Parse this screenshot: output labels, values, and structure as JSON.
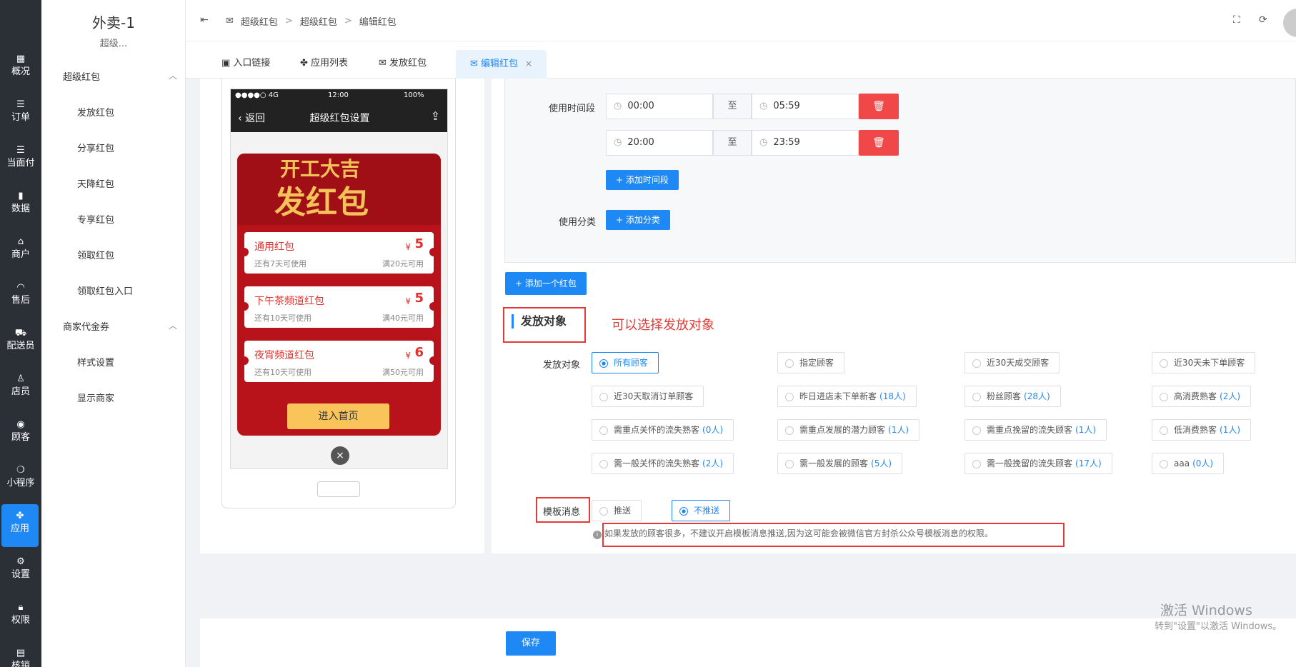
{
  "leftnav": [
    {
      "icon": "dashboard-icon",
      "glyph": "▦",
      "label": "概况"
    },
    {
      "icon": "list-icon",
      "glyph": "☰",
      "label": "订单"
    },
    {
      "icon": "list-icon",
      "glyph": "☰",
      "label": "当面付"
    },
    {
      "icon": "bar-chart-icon",
      "glyph": "▮",
      "label": "数据"
    },
    {
      "icon": "store-icon",
      "glyph": "⌂",
      "label": "商户"
    },
    {
      "icon": "headset-icon",
      "glyph": "◠",
      "label": "售后"
    },
    {
      "icon": "truck-icon",
      "glyph": "⛟",
      "label": "配送员"
    },
    {
      "icon": "people-icon",
      "glyph": "♙",
      "label": "店员"
    },
    {
      "icon": "user-circle-icon",
      "glyph": "◉",
      "label": "顾客"
    },
    {
      "icon": "wechat-icon",
      "glyph": "❍",
      "label": "小程序"
    },
    {
      "icon": "apps-icon",
      "glyph": "✤",
      "label": "应用"
    },
    {
      "icon": "settings-user-icon",
      "glyph": "⚙",
      "label": "设置"
    },
    {
      "icon": "lock-icon",
      "glyph": "🔒︎",
      "label": "权限"
    },
    {
      "icon": "document-icon",
      "glyph": "▤",
      "label": "核销"
    }
  ],
  "subnav": {
    "title": "外卖-1",
    "subtitle": "超级...",
    "group1": "超级红包",
    "group1_items": [
      "发放红包",
      "分享红包",
      "天降红包",
      "专享红包",
      "领取红包",
      "领取红包入口"
    ],
    "group2": "商家代金券",
    "group2_items": [
      "样式设置",
      "显示商家"
    ]
  },
  "breadcrumb": [
    "超级红包",
    "超级红包",
    "编辑红包"
  ],
  "tabs": [
    {
      "label": "入口链接",
      "icon": "vip-icon"
    },
    {
      "label": "应用列表",
      "icon": "apps-icon"
    },
    {
      "label": "发放红包",
      "icon": "envelope-icon"
    },
    {
      "label": "编辑红包",
      "icon": "envelope-icon",
      "active": true
    }
  ],
  "phone": {
    "carrier": "●●●●○ 4G",
    "time": "12:00",
    "battery": "100%",
    "back": "返回",
    "title": "超级红包设置",
    "banner1": "开工大吉",
    "banner2": "发红包",
    "coupons": [
      {
        "name": "通用红包",
        "amount": "5",
        "sub": "还有7天可使用",
        "cond": "满20元可用"
      },
      {
        "name": "下午茶频道红包",
        "amount": "5",
        "sub": "还有10天可使用",
        "cond": "满40元可用"
      },
      {
        "name": "夜宵频道红包",
        "amount": "6",
        "sub": "还有10天可使用",
        "cond": "满50元可用"
      }
    ],
    "yen": "¥",
    "enter": "进入首页"
  },
  "form": {
    "time_label": "使用时间段",
    "ranges": [
      {
        "start": "00:00",
        "end": "05:59"
      },
      {
        "start": "20:00",
        "end": "23:59"
      }
    ],
    "to": "至",
    "add_time": "+ 添加时间段",
    "category_label": "使用分类",
    "add_category": "+ 添加分类",
    "add_packet": "+ 添加一个红包",
    "section": "发放对象",
    "annotation": "可以选择发放对象",
    "target_label": "发放对象",
    "targets": [
      {
        "label": "所有顾客",
        "count": "",
        "checked": true
      },
      {
        "label": "指定顾客",
        "count": ""
      },
      {
        "label": "近30天成交顾客",
        "count": ""
      },
      {
        "label": "近30天未下单顾客",
        "count": ""
      },
      {
        "label": "近30天取消订单顾客",
        "count": ""
      },
      {
        "label": "昨日进店未下单新客",
        "count": "(18人)"
      },
      {
        "label": "粉丝顾客",
        "count": "(28人)"
      },
      {
        "label": "高消费熟客",
        "count": "(2人)"
      },
      {
        "label": "需重点关怀的流失熟客",
        "count": "(0人)"
      },
      {
        "label": "需重点发展的潜力顾客",
        "count": "(1人)"
      },
      {
        "label": "需重点挽留的流失顾客",
        "count": "(1人)"
      },
      {
        "label": "低消费熟客",
        "count": "(1人)"
      },
      {
        "label": "需一般关怀的流失熟客",
        "count": "(2人)"
      },
      {
        "label": "需一般发展的顾客",
        "count": "(5人)"
      },
      {
        "label": "需一般挽留的流失顾客",
        "count": "(17人)"
      },
      {
        "label": "aaa",
        "count": "(0人)"
      }
    ],
    "template_label": "模板消息",
    "push": "推送",
    "no_push": "不推送",
    "hint": "如果发放的顾客很多，不建议开启模板消息推送,因为这可能会被微信官方封杀公众号模板消息的权限。"
  },
  "save": "保存",
  "watermark": {
    "line1": "激活 Windows",
    "line2": "转到\"设置\"以激活 Windows。"
  }
}
